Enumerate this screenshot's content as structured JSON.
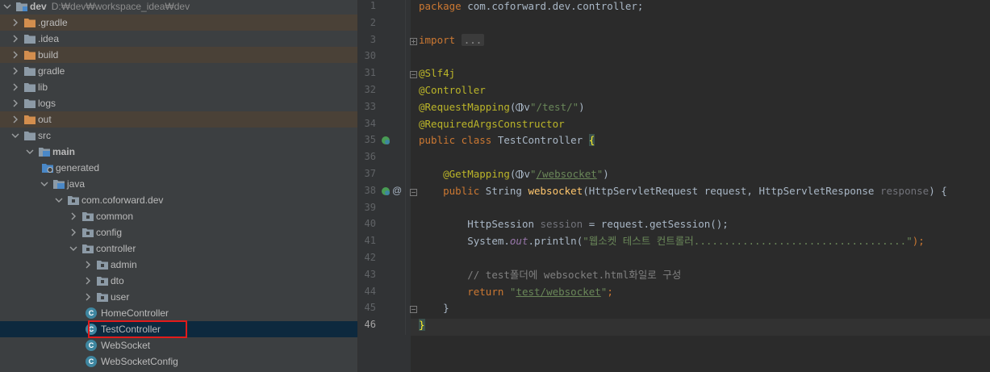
{
  "project": {
    "root_name": "dev",
    "root_path": "D:₩dev₩workspace_idea₩dev",
    "items": [
      {
        "label": "dev"
      },
      {
        "label": ".gradle"
      },
      {
        "label": ".idea"
      },
      {
        "label": "build"
      },
      {
        "label": "gradle"
      },
      {
        "label": "lib"
      },
      {
        "label": "logs"
      },
      {
        "label": "out"
      },
      {
        "label": "src"
      },
      {
        "label": "main"
      },
      {
        "label": "generated"
      },
      {
        "label": "java"
      },
      {
        "label": "com.coforward.dev"
      },
      {
        "label": "common"
      },
      {
        "label": "config"
      },
      {
        "label": "controller"
      },
      {
        "label": "admin"
      },
      {
        "label": "dto"
      },
      {
        "label": "user"
      },
      {
        "label": "HomeController"
      },
      {
        "label": "TestController"
      },
      {
        "label": "WebSocket"
      },
      {
        "label": "WebSocketConfig"
      }
    ],
    "class_icon_letter": "C"
  },
  "editor": {
    "line_numbers": [
      "1",
      "2",
      "3",
      "30",
      "31",
      "32",
      "33",
      "34",
      "35",
      "36",
      "37",
      "38",
      "39",
      "40",
      "41",
      "42",
      "43",
      "44",
      "45",
      "46"
    ],
    "gutter_at": "@",
    "code": {
      "l1_kw": "package",
      "l1_rest": " com.coforward.dev.controller;",
      "l3_kw": "import",
      "l3_fold": "...",
      "l31": "@Slf4j",
      "l32": "@Controller",
      "l33_ann": "@RequestMapping",
      "l33_open": "(",
      "l33_chev": "v",
      "l33_str": "\"/test/\"",
      "l33_close": ")",
      "l34": "@RequiredArgsConstructor",
      "l35_kw": "public class",
      "l35_name": " TestController ",
      "l35_brace": "{",
      "l37_ann": "@GetMapping",
      "l37_open": "(",
      "l37_chev": "v",
      "l37_q1": "\"",
      "l37_url": "/websocket",
      "l37_q2": "\"",
      "l37_close": ")",
      "l38_kw": "public",
      "l38_type": " String ",
      "l38_fn": "websocket",
      "l38_args": "(HttpServletRequest request, HttpServletResponse ",
      "l38_param": "response",
      "l38_end": ") {",
      "l40_a": "HttpSession ",
      "l40_var": "session",
      "l40_b": " = request.getSession();",
      "l41_a": "System.",
      "l41_field": "out",
      "l41_b": ".println(",
      "l41_str": "\"웹소켓 테스트 컨트롤러...................................\"",
      "l41_c": ");",
      "l43": "// test폴더에 websocket.html화일로 구성",
      "l44_kw": "return",
      "l44_q1": " \"",
      "l44_url": "test/websocket",
      "l44_q2": "\"",
      "l44_semi": ";",
      "l45": "}",
      "l46": "}"
    }
  },
  "colors": {
    "tree_bg": "#3c3f41",
    "editor_bg": "#2b2b2b",
    "excluded_folder_bg": "#4a4137",
    "selected_bg": "#0d293e",
    "highlight_box": "#e01b1b",
    "keyword": "#cc7832",
    "annotation": "#bbb529",
    "string": "#6a8759"
  }
}
